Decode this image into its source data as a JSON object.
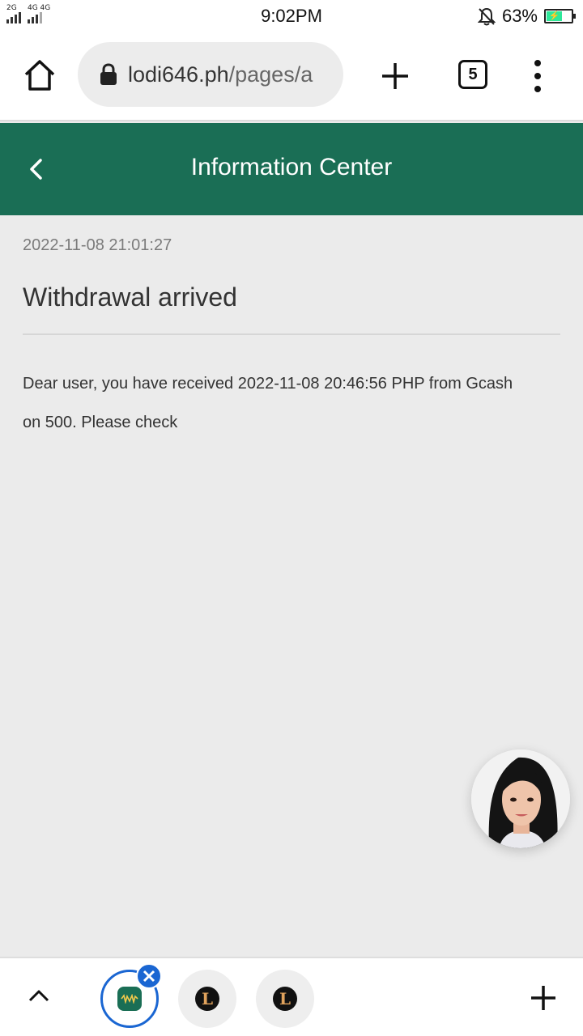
{
  "status_bar": {
    "sig1_label": "2G",
    "sig2_label": "4G 4G",
    "time": "9:02PM",
    "battery_percent": "63%",
    "battery_level": 0.63,
    "battery_color": "#2ee89a"
  },
  "browser": {
    "url_host": "lodi646.ph",
    "url_path": "/pages/a",
    "tab_count": "5"
  },
  "header": {
    "title": "Information Center",
    "color": "#1a6e55"
  },
  "message": {
    "date": "2022-11-08 21:01:27",
    "title": "Withdrawal arrived",
    "body": "Dear user, you have received 2022-11-08 20:46:56 PHP from Gcash on 500. Please check"
  },
  "icons": {
    "home": "home-icon",
    "lock": "lock-icon",
    "new_tab": "plus-icon",
    "menu": "more-vert-icon",
    "back": "chevron-left-icon",
    "support": "support-avatar",
    "expand": "chevron-up-icon",
    "close": "close-icon"
  },
  "bottom_bar": {
    "tabs": [
      {
        "label": "lodi646 app tab",
        "active": true
      },
      {
        "label": "L tab"
      },
      {
        "label": "L tab"
      }
    ],
    "accent": "#1a66d2"
  }
}
